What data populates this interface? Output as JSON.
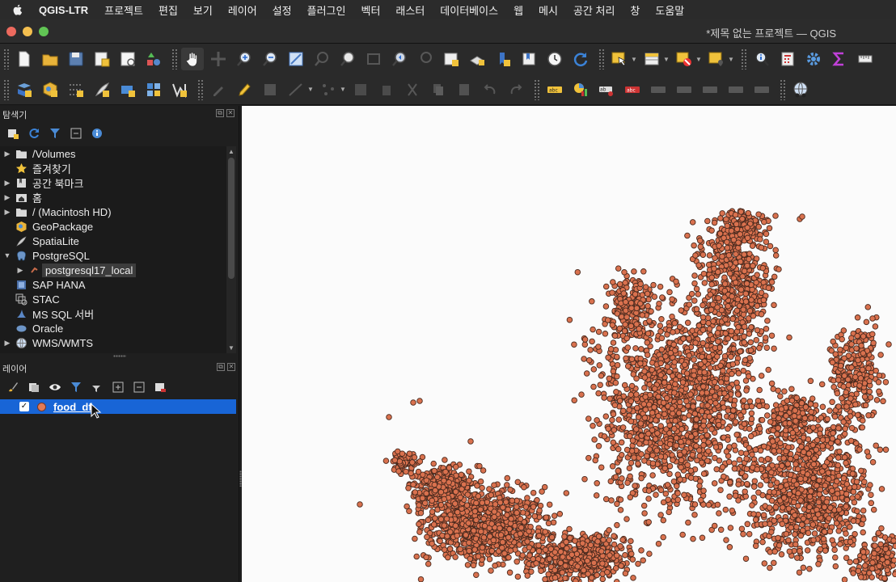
{
  "menubar": {
    "app_name": "QGIS-LTR",
    "items": [
      "프로젝트",
      "편집",
      "보기",
      "레이어",
      "설정",
      "플러그인",
      "벡터",
      "래스터",
      "데이터베이스",
      "웹",
      "메시",
      "공간 처리",
      "창",
      "도움말"
    ]
  },
  "window": {
    "title": "*제목 없는 프로젝트 — QGIS"
  },
  "browser_panel": {
    "title": "탐색기",
    "items": [
      {
        "label": "/Volumes",
        "icon": "folder-icon",
        "expandable": true
      },
      {
        "label": "즐겨찾기",
        "icon": "star-icon",
        "expandable": false
      },
      {
        "label": "공간 북마크",
        "icon": "bookmark-icon",
        "expandable": true
      },
      {
        "label": "홈",
        "icon": "home-folder-icon",
        "expandable": true
      },
      {
        "label": "/ (Macintosh HD)",
        "icon": "folder-icon",
        "expandable": true
      },
      {
        "label": "GeoPackage",
        "icon": "geopackage-icon",
        "expandable": false
      },
      {
        "label": "SpatiaLite",
        "icon": "spatialite-icon",
        "expandable": false
      },
      {
        "label": "PostgreSQL",
        "icon": "postgresql-icon",
        "expandable": true,
        "expanded": true
      },
      {
        "label": "postgresql17_local",
        "icon": "db-connection-icon",
        "expandable": true,
        "child": true,
        "selected": true
      },
      {
        "label": "SAP HANA",
        "icon": "sap-hana-icon",
        "expandable": false
      },
      {
        "label": "STAC",
        "icon": "stac-icon",
        "expandable": false
      },
      {
        "label": "MS SQL 서버",
        "icon": "mssql-icon",
        "expandable": false
      },
      {
        "label": "Oracle",
        "icon": "oracle-icon",
        "expandable": false
      },
      {
        "label": "WMS/WMTS",
        "icon": "wms-icon",
        "expandable": true
      }
    ]
  },
  "layers_panel": {
    "title": "레이어",
    "layers": [
      {
        "name": "food_df",
        "visible": true,
        "checkmark": "✓",
        "symbol_color": "#e07a56"
      }
    ]
  },
  "map": {
    "background": "#fbfbfb",
    "point_fill": "#d9714e",
    "point_stroke": "#4a2a1e"
  },
  "colors": {
    "selection": "#1865d6",
    "panel_bg": "#1f1f1f",
    "toolbar_bg": "#2a2a2a"
  }
}
